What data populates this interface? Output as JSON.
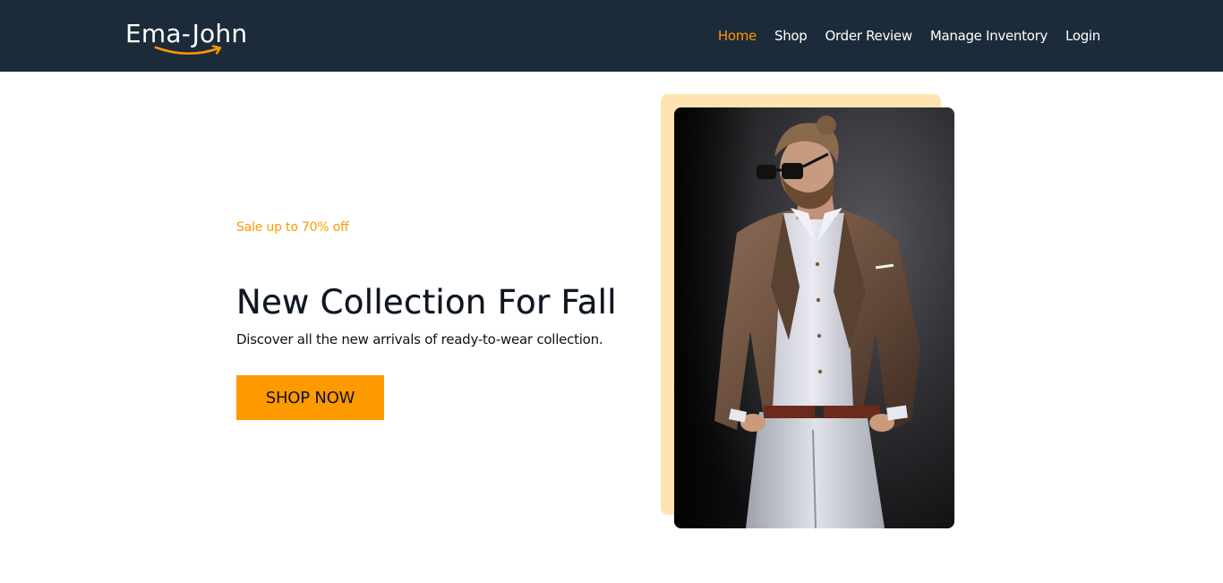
{
  "header": {
    "logo_text": "Ema-John",
    "nav": [
      {
        "label": "Home",
        "active": true
      },
      {
        "label": "Shop",
        "active": false
      },
      {
        "label": "Order Review",
        "active": false
      },
      {
        "label": "Manage Inventory",
        "active": false
      },
      {
        "label": "Login",
        "active": false
      }
    ]
  },
  "hero": {
    "sale_text": "Sale up to 70% off",
    "headline": "New Collection For Fall",
    "subline": "Discover all the new arrivals of ready-to-wear collection.",
    "cta_label": "SHOP NOW"
  },
  "colors": {
    "navbar_bg": "#1c2b39",
    "accent": "#ff9900",
    "image_backdrop": "#ffe3b1"
  }
}
